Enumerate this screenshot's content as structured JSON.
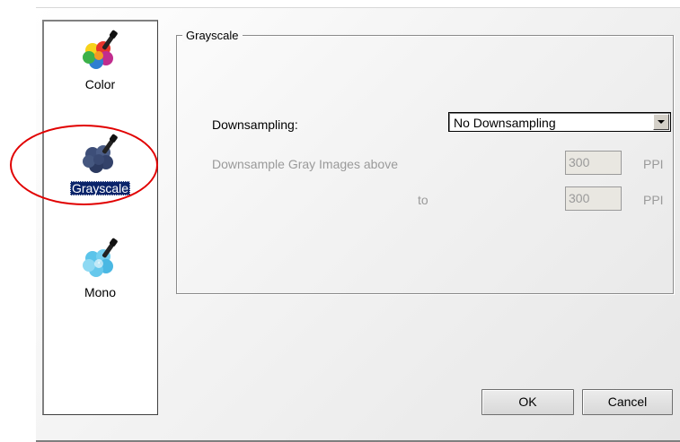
{
  "group_title": "Grayscale",
  "categories": [
    {
      "label": "Color",
      "icon": "color-dropper-icon",
      "selected": false
    },
    {
      "label": "Grayscale",
      "icon": "grayscale-dropper-icon",
      "selected": true
    },
    {
      "label": "Mono",
      "icon": "mono-dropper-icon",
      "selected": false
    }
  ],
  "downsampling": {
    "label": "Downsampling:",
    "value": "No Downsampling"
  },
  "downsample_above": {
    "label": "Downsample Gray Images above",
    "value": "300",
    "unit": "PPI"
  },
  "downsample_to": {
    "label": "to",
    "value": "300",
    "unit": "PPI"
  },
  "buttons": {
    "ok": "OK",
    "cancel": "Cancel"
  },
  "colors": {
    "selection": "#0a246a",
    "annotation": "#e10000",
    "disabled_text": "#9a9a9a"
  }
}
